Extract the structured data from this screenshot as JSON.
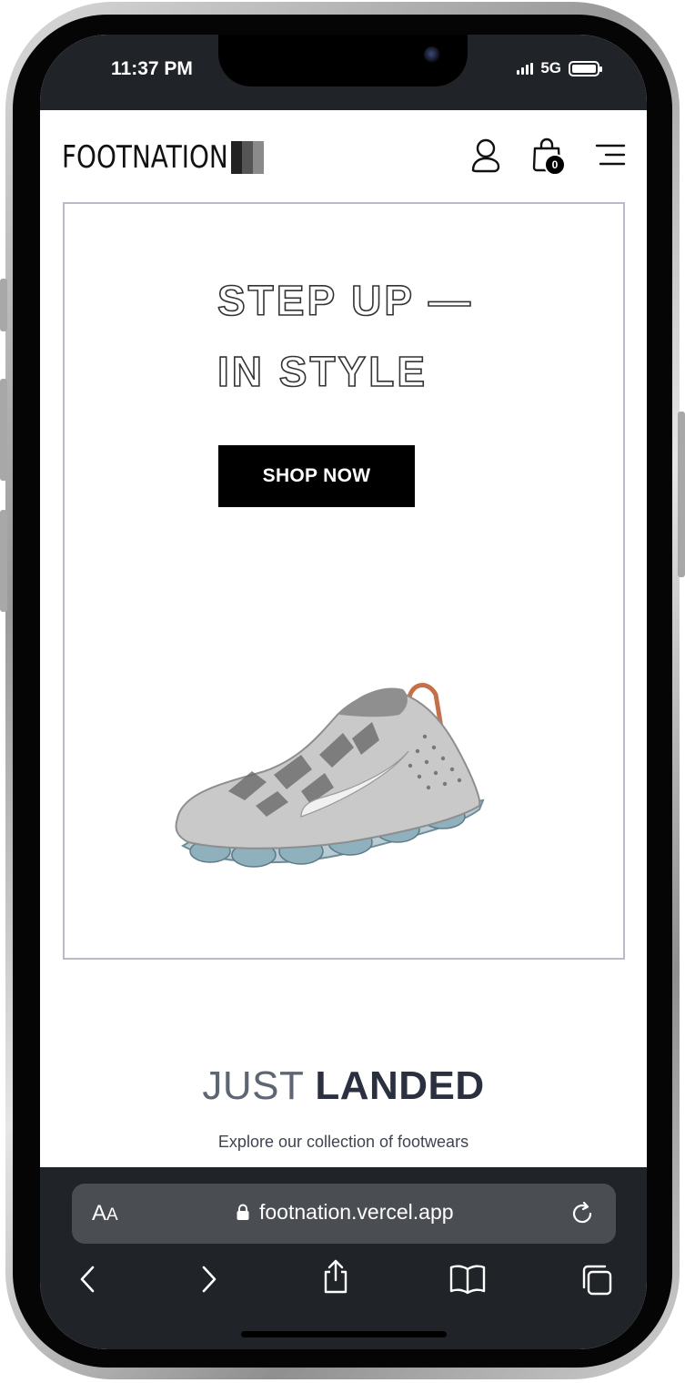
{
  "status_bar": {
    "time": "11:37 PM",
    "network": "5G",
    "battery_level": 1.0
  },
  "header": {
    "logo_text": "FOOTNATION",
    "logo_bar_colors": [
      "#222222",
      "#555555",
      "#888888"
    ],
    "user_icon": "user-icon",
    "cart_icon": "shopping-bag-icon",
    "cart_count": "0",
    "menu_icon": "hamburger-menu-icon"
  },
  "hero": {
    "title_line1": "STEP UP —",
    "title_line2": "IN STYLE",
    "cta_label": "SHOP NOW",
    "image": "sneaker-image"
  },
  "just_landed": {
    "title_light": "JUST",
    "title_bold": "LANDED",
    "subtitle": "Explore our collection of footwears"
  },
  "browser": {
    "text_size_label": "AA",
    "url": "footnation.vercel.app",
    "lock_icon": "lock-icon",
    "reload_icon": "reload-icon",
    "toolbar": [
      "back-icon",
      "forward-icon",
      "share-icon",
      "bookmarks-icon",
      "tabs-icon"
    ]
  },
  "colors": {
    "status_bg": "#202428",
    "cta_bg": "#000000",
    "hero_border": "#b9bcc7",
    "landed_light": "#5e6573",
    "landed_bold": "#2a3040"
  }
}
